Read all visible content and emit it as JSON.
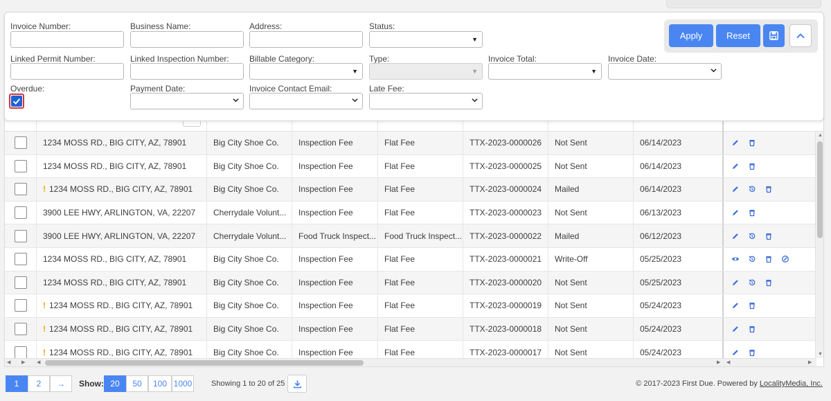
{
  "filters": {
    "invoice_number": {
      "label": "Invoice Number:",
      "value": ""
    },
    "business_name": {
      "label": "Business Name:",
      "value": ""
    },
    "address": {
      "label": "Address:",
      "value": ""
    },
    "status": {
      "label": "Status:",
      "value": ""
    },
    "linked_permit_number": {
      "label": "Linked Permit Number:",
      "value": ""
    },
    "linked_inspection_number": {
      "label": "Linked Inspection Number:",
      "value": ""
    },
    "billable_category": {
      "label": "Billable Category:",
      "value": ""
    },
    "type": {
      "label": "Type:",
      "value": ""
    },
    "invoice_total": {
      "label": "Invoice Total:",
      "value": ""
    },
    "invoice_date": {
      "label": "Invoice Date:",
      "value": ""
    },
    "overdue": {
      "label": "Overdue:",
      "checked": true
    },
    "payment_date": {
      "label": "Payment Date:",
      "value": ""
    },
    "invoice_contact_email": {
      "label": "Invoice Contact Email:",
      "value": ""
    },
    "late_fee": {
      "label": "Late Fee:",
      "value": ""
    }
  },
  "buttons": {
    "apply": "Apply",
    "reset": "Reset",
    "save_icon": "save-icon",
    "collapse_icon": "chevron-up-icon"
  },
  "rows": [
    {
      "warn": false,
      "address": "1234 MOSS RD., BIG CITY, AZ, 78901",
      "business": "Big City Shoe Co.",
      "category": "Inspection Fee",
      "type": "Flat Fee",
      "invoice": "TTX-2023-0000026",
      "status": "Not Sent",
      "date": "06/14/2023",
      "actions": [
        "edit-icon",
        "delete-icon"
      ]
    },
    {
      "warn": false,
      "address": "1234 MOSS RD., BIG CITY, AZ, 78901",
      "business": "Big City Shoe Co.",
      "category": "Inspection Fee",
      "type": "Flat Fee",
      "invoice": "TTX-2023-0000025",
      "status": "Not Sent",
      "date": "06/14/2023",
      "actions": [
        "edit-icon",
        "delete-icon"
      ]
    },
    {
      "warn": true,
      "address": "1234 MOSS RD., BIG CITY, AZ, 78901",
      "business": "Big City Shoe Co.",
      "category": "Inspection Fee",
      "type": "Flat Fee",
      "invoice": "TTX-2023-0000024",
      "status": "Mailed",
      "date": "06/14/2023",
      "actions": [
        "edit-icon",
        "history-icon",
        "delete-icon"
      ]
    },
    {
      "warn": false,
      "address": "3900 LEE HWY, ARLINGTON, VA, 22207",
      "business": "Cherrydale Volunt...",
      "category": "Inspection Fee",
      "type": "Flat Fee",
      "invoice": "TTX-2023-0000023",
      "status": "Not Sent",
      "date": "06/13/2023",
      "actions": [
        "edit-icon",
        "delete-icon"
      ]
    },
    {
      "warn": false,
      "address": "3900 LEE HWY, ARLINGTON, VA, 22207",
      "business": "Cherrydale Volunt...",
      "category": "Food Truck Inspect...",
      "type": "Food Truck Inspect...",
      "invoice": "TTX-2023-0000022",
      "status": "Mailed",
      "date": "06/12/2023",
      "actions": [
        "edit-icon",
        "history-icon",
        "delete-icon"
      ]
    },
    {
      "warn": false,
      "address": "1234 MOSS RD., BIG CITY, AZ, 78901",
      "business": "Big City Shoe Co.",
      "category": "Inspection Fee",
      "type": "Flat Fee",
      "invoice": "TTX-2023-0000021",
      "status": "Write-Off",
      "date": "05/25/2023",
      "actions": [
        "view-icon",
        "history-icon",
        "delete-icon",
        "undo-writeoff-icon"
      ]
    },
    {
      "warn": false,
      "address": "1234 MOSS RD., BIG CITY, AZ, 78901",
      "business": "Big City Shoe Co.",
      "category": "Inspection Fee",
      "type": "Flat Fee",
      "invoice": "TTX-2023-0000020",
      "status": "Not Sent",
      "date": "05/25/2023",
      "actions": [
        "edit-icon",
        "history-icon",
        "delete-icon"
      ]
    },
    {
      "warn": true,
      "address": "1234 MOSS RD., BIG CITY, AZ, 78901",
      "business": "Big City Shoe Co.",
      "category": "Inspection Fee",
      "type": "Flat Fee",
      "invoice": "TTX-2023-0000019",
      "status": "Not Sent",
      "date": "05/24/2023",
      "actions": [
        "edit-icon",
        "delete-icon"
      ]
    },
    {
      "warn": true,
      "address": "1234 MOSS RD., BIG CITY, AZ, 78901",
      "business": "Big City Shoe Co.",
      "category": "Inspection Fee",
      "type": "Flat Fee",
      "invoice": "TTX-2023-0000018",
      "status": "Not Sent",
      "date": "05/24/2023",
      "actions": [
        "edit-icon",
        "delete-icon"
      ]
    },
    {
      "warn": true,
      "address": "1234 MOSS RD., BIG CITY, AZ, 78901",
      "business": "Big City Shoe Co.",
      "category": "Inspection Fee",
      "type": "Flat Fee",
      "invoice": "TTX-2023-0000017",
      "status": "Not Sent",
      "date": "05/24/2023",
      "actions": [
        "edit-icon",
        "delete-icon"
      ]
    }
  ],
  "pagination": {
    "pages": [
      "1",
      "2"
    ],
    "active_page": "1",
    "next": "→",
    "show_label": "Show:",
    "page_sizes": [
      "20",
      "50",
      "100",
      "1000"
    ],
    "active_size": "20",
    "showing_text": "Showing 1 to 20 of 25",
    "download_icon": "download-icon"
  },
  "footer": {
    "copyright_prefix": "© 2017-2023 First Due. Powered by ",
    "powered_by_link": "LocalityMedia, Inc."
  },
  "colors": {
    "accent": "#4a86f2",
    "checkbox_checked": "#1d63d6",
    "focus_outline": "#d9333f",
    "warning": "#f0a500"
  }
}
